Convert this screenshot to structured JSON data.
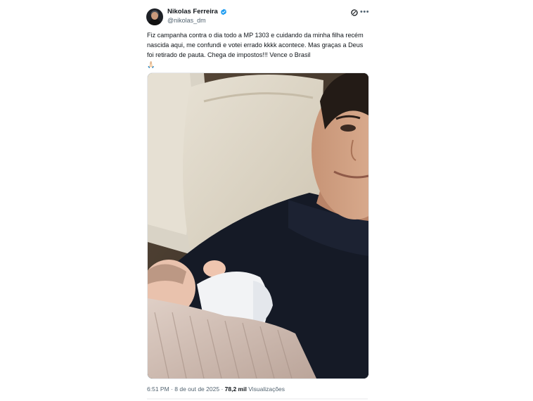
{
  "author": {
    "name": "Nikolas Ferreira",
    "handle": "@nikolas_dm",
    "verified": true,
    "avatar_icon": "avatar-photo"
  },
  "tweet": {
    "text": "Fiz campanha contra o dia todo a MP 1303 e cuidando da minha filha recém nascida aqui, me confundi e votei errado kkkk acontece. Mas graças a Deus foi retirado de pauta. Chega de impostos!!! Vence o Brasil\n🙏🏻",
    "media_description_icon": "selfie-photo"
  },
  "meta": {
    "time": "6:51 PM",
    "separator": "·",
    "date": "8 de out de 2025",
    "views_count": "78,2 mil",
    "views_label": "Visualizações"
  },
  "colors": {
    "verified_blue": "#1d9bf0",
    "text": "#0f1419",
    "muted": "#536471"
  },
  "icons": [
    "verified-badge-icon",
    "grok-icon",
    "more-options-icon"
  ]
}
